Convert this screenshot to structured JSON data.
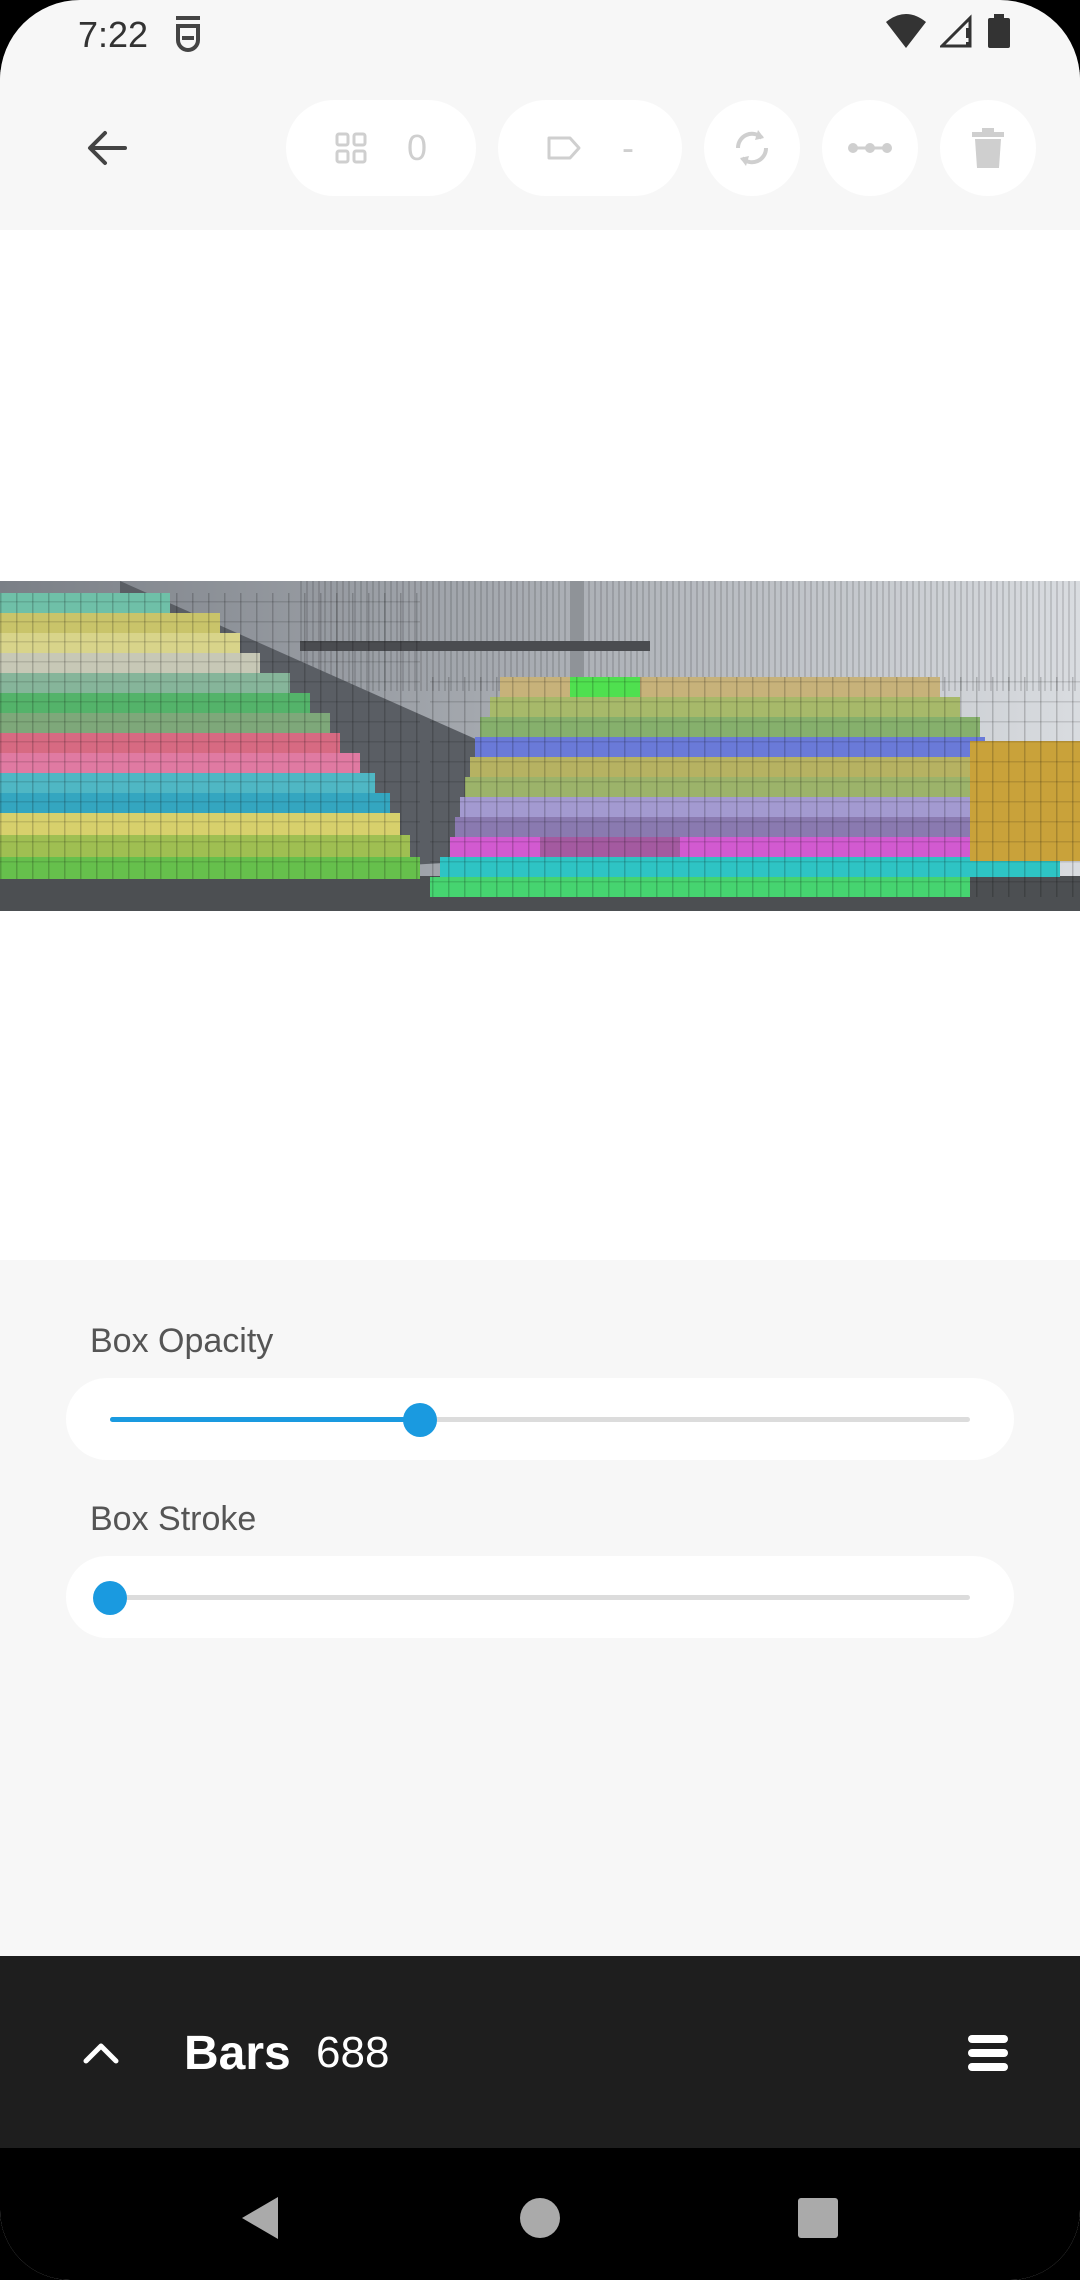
{
  "status_bar": {
    "time": "7:22"
  },
  "toolbar": {
    "count_value": "0",
    "label_value": "-"
  },
  "settings": {
    "box_opacity": {
      "label": "Box Opacity",
      "value": 0.36
    },
    "box_stroke": {
      "label": "Box Stroke",
      "value": 0.0
    }
  },
  "bottom_bar": {
    "title": "Bars",
    "count": "688"
  },
  "colors": {
    "accent": "#1a9ae0",
    "bottom_bar_bg": "#1e1e1e",
    "disabled_icon": "#cfcfcf"
  }
}
